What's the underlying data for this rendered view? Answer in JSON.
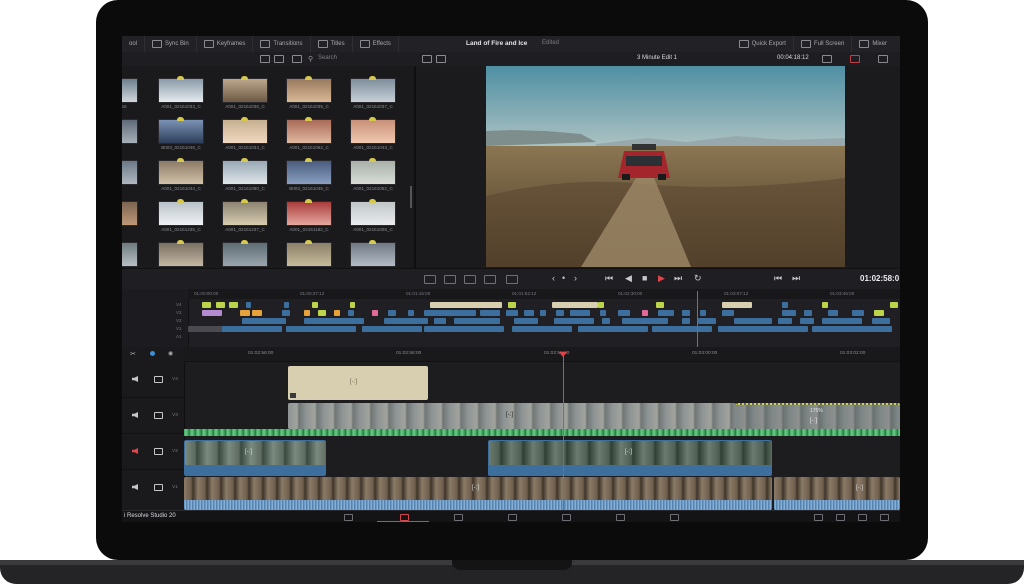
{
  "device": "laptop",
  "topbar": {
    "media_label": "ool",
    "sync_bin": "Sync Bin",
    "keyframes": "Keyframes",
    "transitions": "Transitions",
    "titles": "Titles",
    "effects": "Effects",
    "project_title": "Land of Fire and Ice",
    "status": "Edited",
    "quick_export": "Quick Export",
    "full_screen": "Full Screen",
    "mixer": "Mixer"
  },
  "toolbar": {
    "search_placeholder": "Search",
    "timeline_name": "3 Minute Edit 1",
    "timeline_duration": "00:04:18:12"
  },
  "media_pool": {
    "clips": [
      "A001_0216",
      "A001_02161033_C",
      "A001_02161036_C",
      "A001_02161035_C",
      "A001_02161037_C",
      "E_C...",
      "B003_02161046_C",
      "A001_02161034_C",
      "A001_02161062_C",
      "A001_02161043_C",
      "E_C...",
      "A001_02161044_C",
      "A001_02161080_C",
      "B003_02161045_C",
      "A001_02161052_C",
      "E_C...",
      "A001_02161235_C",
      "A001_02161237_C",
      "A001_02161182_C",
      "A001_02161008_C",
      "",
      "",
      "",
      "",
      ""
    ]
  },
  "transport": {
    "timecode": "01:02:58:0"
  },
  "upper_timeline": {
    "ruler": [
      "01:00:00:00",
      "01:00:37:12",
      "01:01:15:00",
      "01:01:52:12",
      "01:02:30:00",
      "01:03:07:12",
      "01:03:45:00"
    ],
    "tracks": [
      "V4",
      "V3",
      "V2",
      "V1",
      "A1"
    ]
  },
  "lower_timeline": {
    "ruler": [
      "01:02:56:00",
      "01:02:58:00",
      "01:02:58:00",
      "01:03:00:00",
      "01:03:02:00"
    ],
    "tracks": [
      {
        "label": "V4",
        "audio_muted": false
      },
      {
        "label": "V3",
        "audio_muted": false
      },
      {
        "label": "V2",
        "audio_muted": true
      },
      {
        "label": "V1",
        "audio_muted": false
      }
    ],
    "clip_marker": "[-:]",
    "speed_badge": "175%"
  },
  "bottom_bar": {
    "app_name": "i Resolve Studio 20",
    "active_page": "cut"
  },
  "colors": {
    "accent_red": "#e0444a",
    "clip_blue": "#3c6e9e",
    "audio_green": "#3fa45e",
    "title_clip": "#d8ceb0",
    "marker_yellow": "#bcd44a",
    "marker_orange": "#e7a23a",
    "marker_pink": "#e26a9b",
    "marker_purple": "#b48bd0"
  }
}
